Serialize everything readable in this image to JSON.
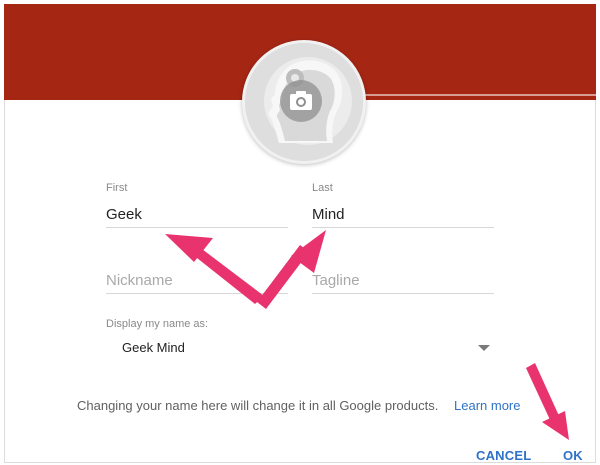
{
  "dialog": {
    "header_color": "#a62614",
    "avatar_icon": "profile-silhouette-icon",
    "camera_icon": "camera-icon"
  },
  "fields": {
    "first": {
      "label": "First",
      "value": "Geek"
    },
    "last": {
      "label": "Last",
      "value": "Mind"
    },
    "nickname": {
      "placeholder": "Nickname"
    },
    "tagline": {
      "placeholder": "Tagline"
    }
  },
  "display_name": {
    "label": "Display my name as:",
    "selected": "Geek Mind"
  },
  "info": {
    "text": "Changing your name here will change it in all Google products.",
    "link": "Learn more"
  },
  "buttons": {
    "cancel": "CANCEL",
    "ok": "OK"
  },
  "annotation": {
    "arrow_color": "#e8336f"
  }
}
